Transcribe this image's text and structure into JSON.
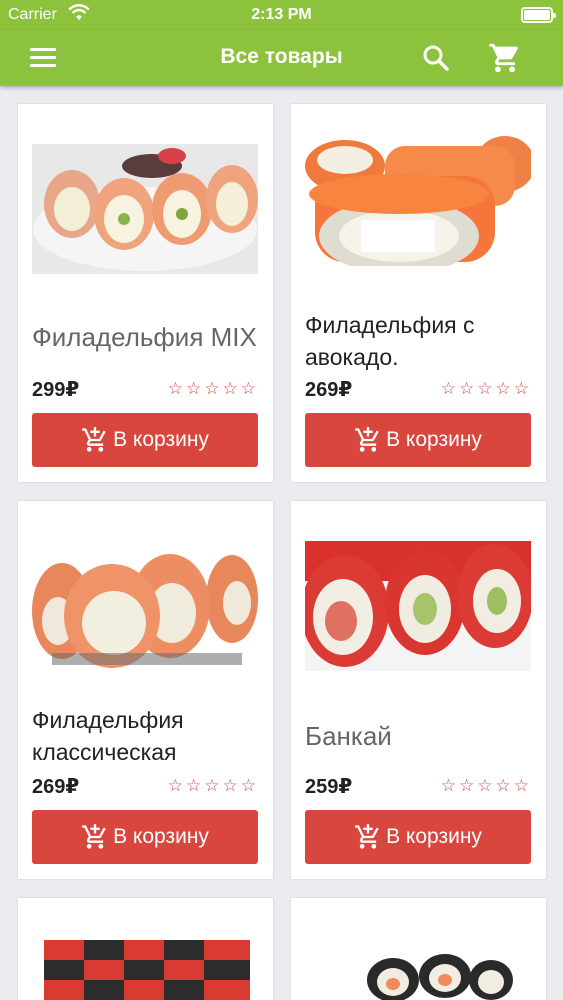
{
  "status_bar": {
    "carrier": "Carrier",
    "time": "2:13 PM"
  },
  "app_bar": {
    "title": "Все товары",
    "menu_icon": "menu-icon",
    "search_icon": "search-icon",
    "cart_icon": "cart-icon"
  },
  "colors": {
    "primary": "#8cc23c",
    "accent": "#d9463e",
    "background": "#ececf0"
  },
  "products": [
    {
      "name": "Филадельфия MIX",
      "price": "299₽",
      "rating": 0,
      "add_label": "В корзину"
    },
    {
      "name": "Филадельфия с авокадо.",
      "price": "269₽",
      "rating": 0,
      "add_label": "В корзину"
    },
    {
      "name": "Филадельфия классическая",
      "price": "269₽",
      "rating": 0,
      "add_label": "В корзину"
    },
    {
      "name": "Банкай",
      "price": "259₽",
      "rating": 0,
      "add_label": "В корзину"
    }
  ]
}
